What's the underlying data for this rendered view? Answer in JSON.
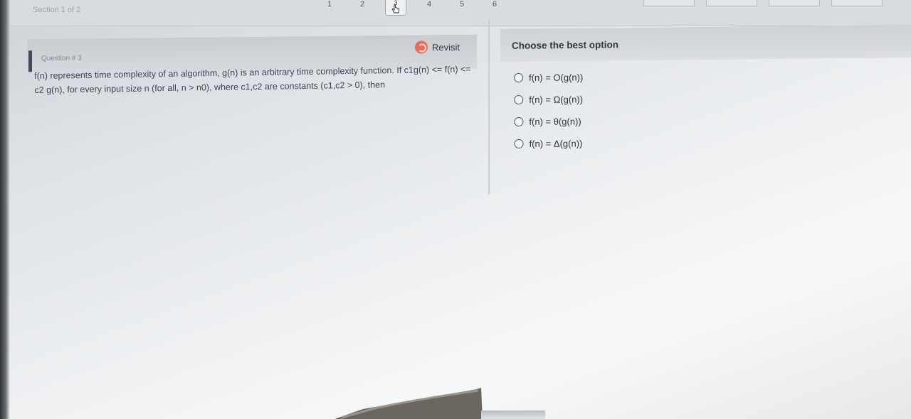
{
  "header": {
    "section_label": "Section 1 of 2",
    "question_numbers": [
      "1",
      "2",
      "3",
      "4",
      "5",
      "6"
    ],
    "current_question": "3"
  },
  "question": {
    "number_label": "Question # 3",
    "revisit_label": "Revisit",
    "text": "f(n) represents time complexity of an algorithm, g(n) is an arbitrary time complexity function. If c1g(n) <= f(n) <= c2 g(n), for every input size n (for all, n > n0), where c1,c2 are constants (c1,c2 > 0), then"
  },
  "options_panel": {
    "title": "Choose the best option",
    "options": [
      {
        "label": "f(n) = O(g(n))"
      },
      {
        "label": "f(n) = Ω(g(n))"
      },
      {
        "label": "f(n) = θ(g(n))"
      },
      {
        "label": "f(n) = Δ(g(n))"
      }
    ]
  },
  "colors": {
    "accent_bar": "#3d4a5a",
    "revisit_icon": "#e76a5a"
  }
}
